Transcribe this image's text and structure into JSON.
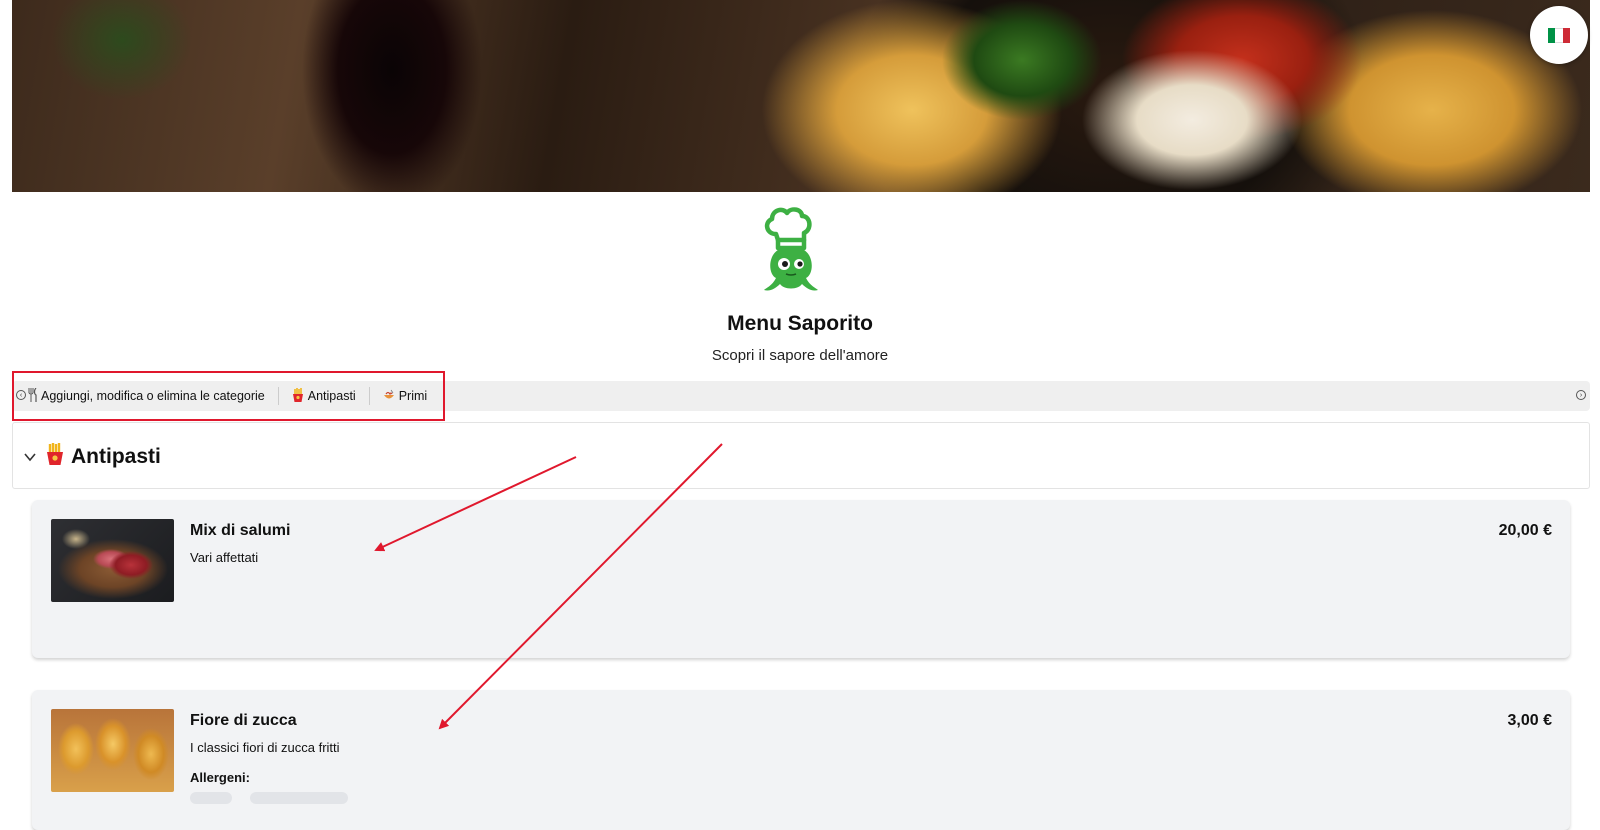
{
  "header": {
    "language_flag_icon": "italy-flag-icon",
    "flag_colors": [
      "#009246",
      "#ffffff",
      "#ce2b37"
    ]
  },
  "brand": {
    "logo_icon": "chef-octopus-logo-icon",
    "logo_color": "#3db043",
    "title": "Menu Saporito",
    "subtitle": "Scopri il sapore dell'amore"
  },
  "category_bar": {
    "items": [
      {
        "icon": "fork-knife-icon",
        "label": "Aggiungi, modifica o elimina le categorie"
      },
      {
        "icon": "fries-icon",
        "label": "Antipasti"
      },
      {
        "icon": "pasta-icon",
        "label": "Primi"
      }
    ],
    "scroll_left_icon": "scroll-left-icon",
    "scroll_right_icon": "scroll-right-icon"
  },
  "section": {
    "title": "Antipasti",
    "icon": "fries-icon",
    "toggle_icon": "chevron-down-icon"
  },
  "dishes": [
    {
      "name": "Mix di salumi",
      "description": "Vari affettati",
      "price": "20,00 €",
      "image": "cured-meats-photo"
    },
    {
      "name": "Fiore di zucca",
      "description": "I classici fiori di zucca fritti",
      "price": "3,00 €",
      "allergens_label": "Allergeni:",
      "image": "fried-zucchini-flowers-photo"
    }
  ],
  "annotation": {
    "highlight_color": "#e0182d"
  }
}
